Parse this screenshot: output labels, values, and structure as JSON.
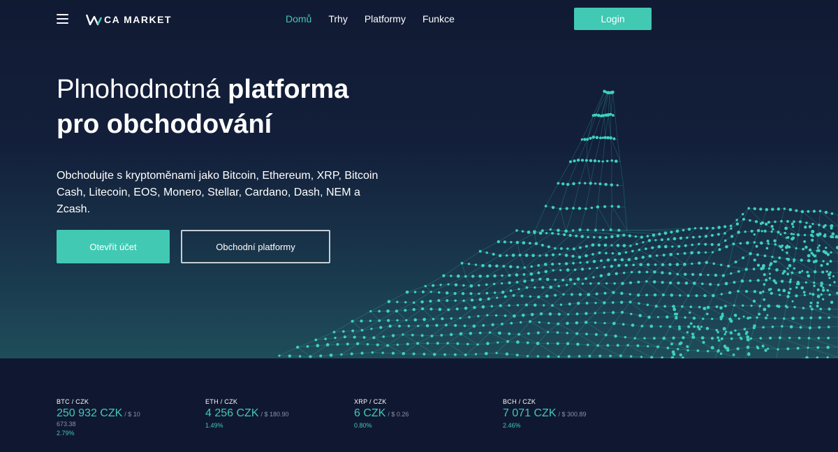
{
  "header": {
    "menu_icon": "hamburger-icon",
    "logo_text": "CA MARKET",
    "nav": [
      {
        "label": "Domů",
        "active": true
      },
      {
        "label": "Trhy",
        "active": false
      },
      {
        "label": "Platformy",
        "active": false
      },
      {
        "label": "Funkce",
        "active": false
      }
    ],
    "login_label": "Login"
  },
  "hero": {
    "title_light": "Plnohodnotná",
    "title_bold_1": "platforma",
    "title_bold_2": "pro obchodování",
    "subtitle": "Obchodujte s kryptoměnami jako Bitcoin, Ethereum, XRP, Bitcoin Cash, Litecoin, EOS, Monero, Stellar, Cardano, Dash, NEM a Zcash.",
    "primary_button": "Otevřít účet",
    "secondary_button": "Obchodní platformy"
  },
  "ticker": [
    {
      "pair": "BTC / CZK",
      "price": "250 932 CZK",
      "usd": "/ $ 10",
      "usd_cont": "673.38",
      "change": "2.79%"
    },
    {
      "pair": "ETH / CZK",
      "price": "4 256 CZK",
      "usd": "/ $ 180.90",
      "usd_cont": "",
      "change": "1.49%"
    },
    {
      "pair": "XRP / CZK",
      "price": "6 CZK",
      "usd": "/ $ 0.26",
      "usd_cont": "",
      "change": "0.80%"
    },
    {
      "pair": "BCH / CZK",
      "price": "7 071 CZK",
      "usd": "/ $ 300.89",
      "usd_cont": "",
      "change": "2.46%"
    }
  ],
  "colors": {
    "accent": "#41c9b4",
    "background": "#101831"
  }
}
